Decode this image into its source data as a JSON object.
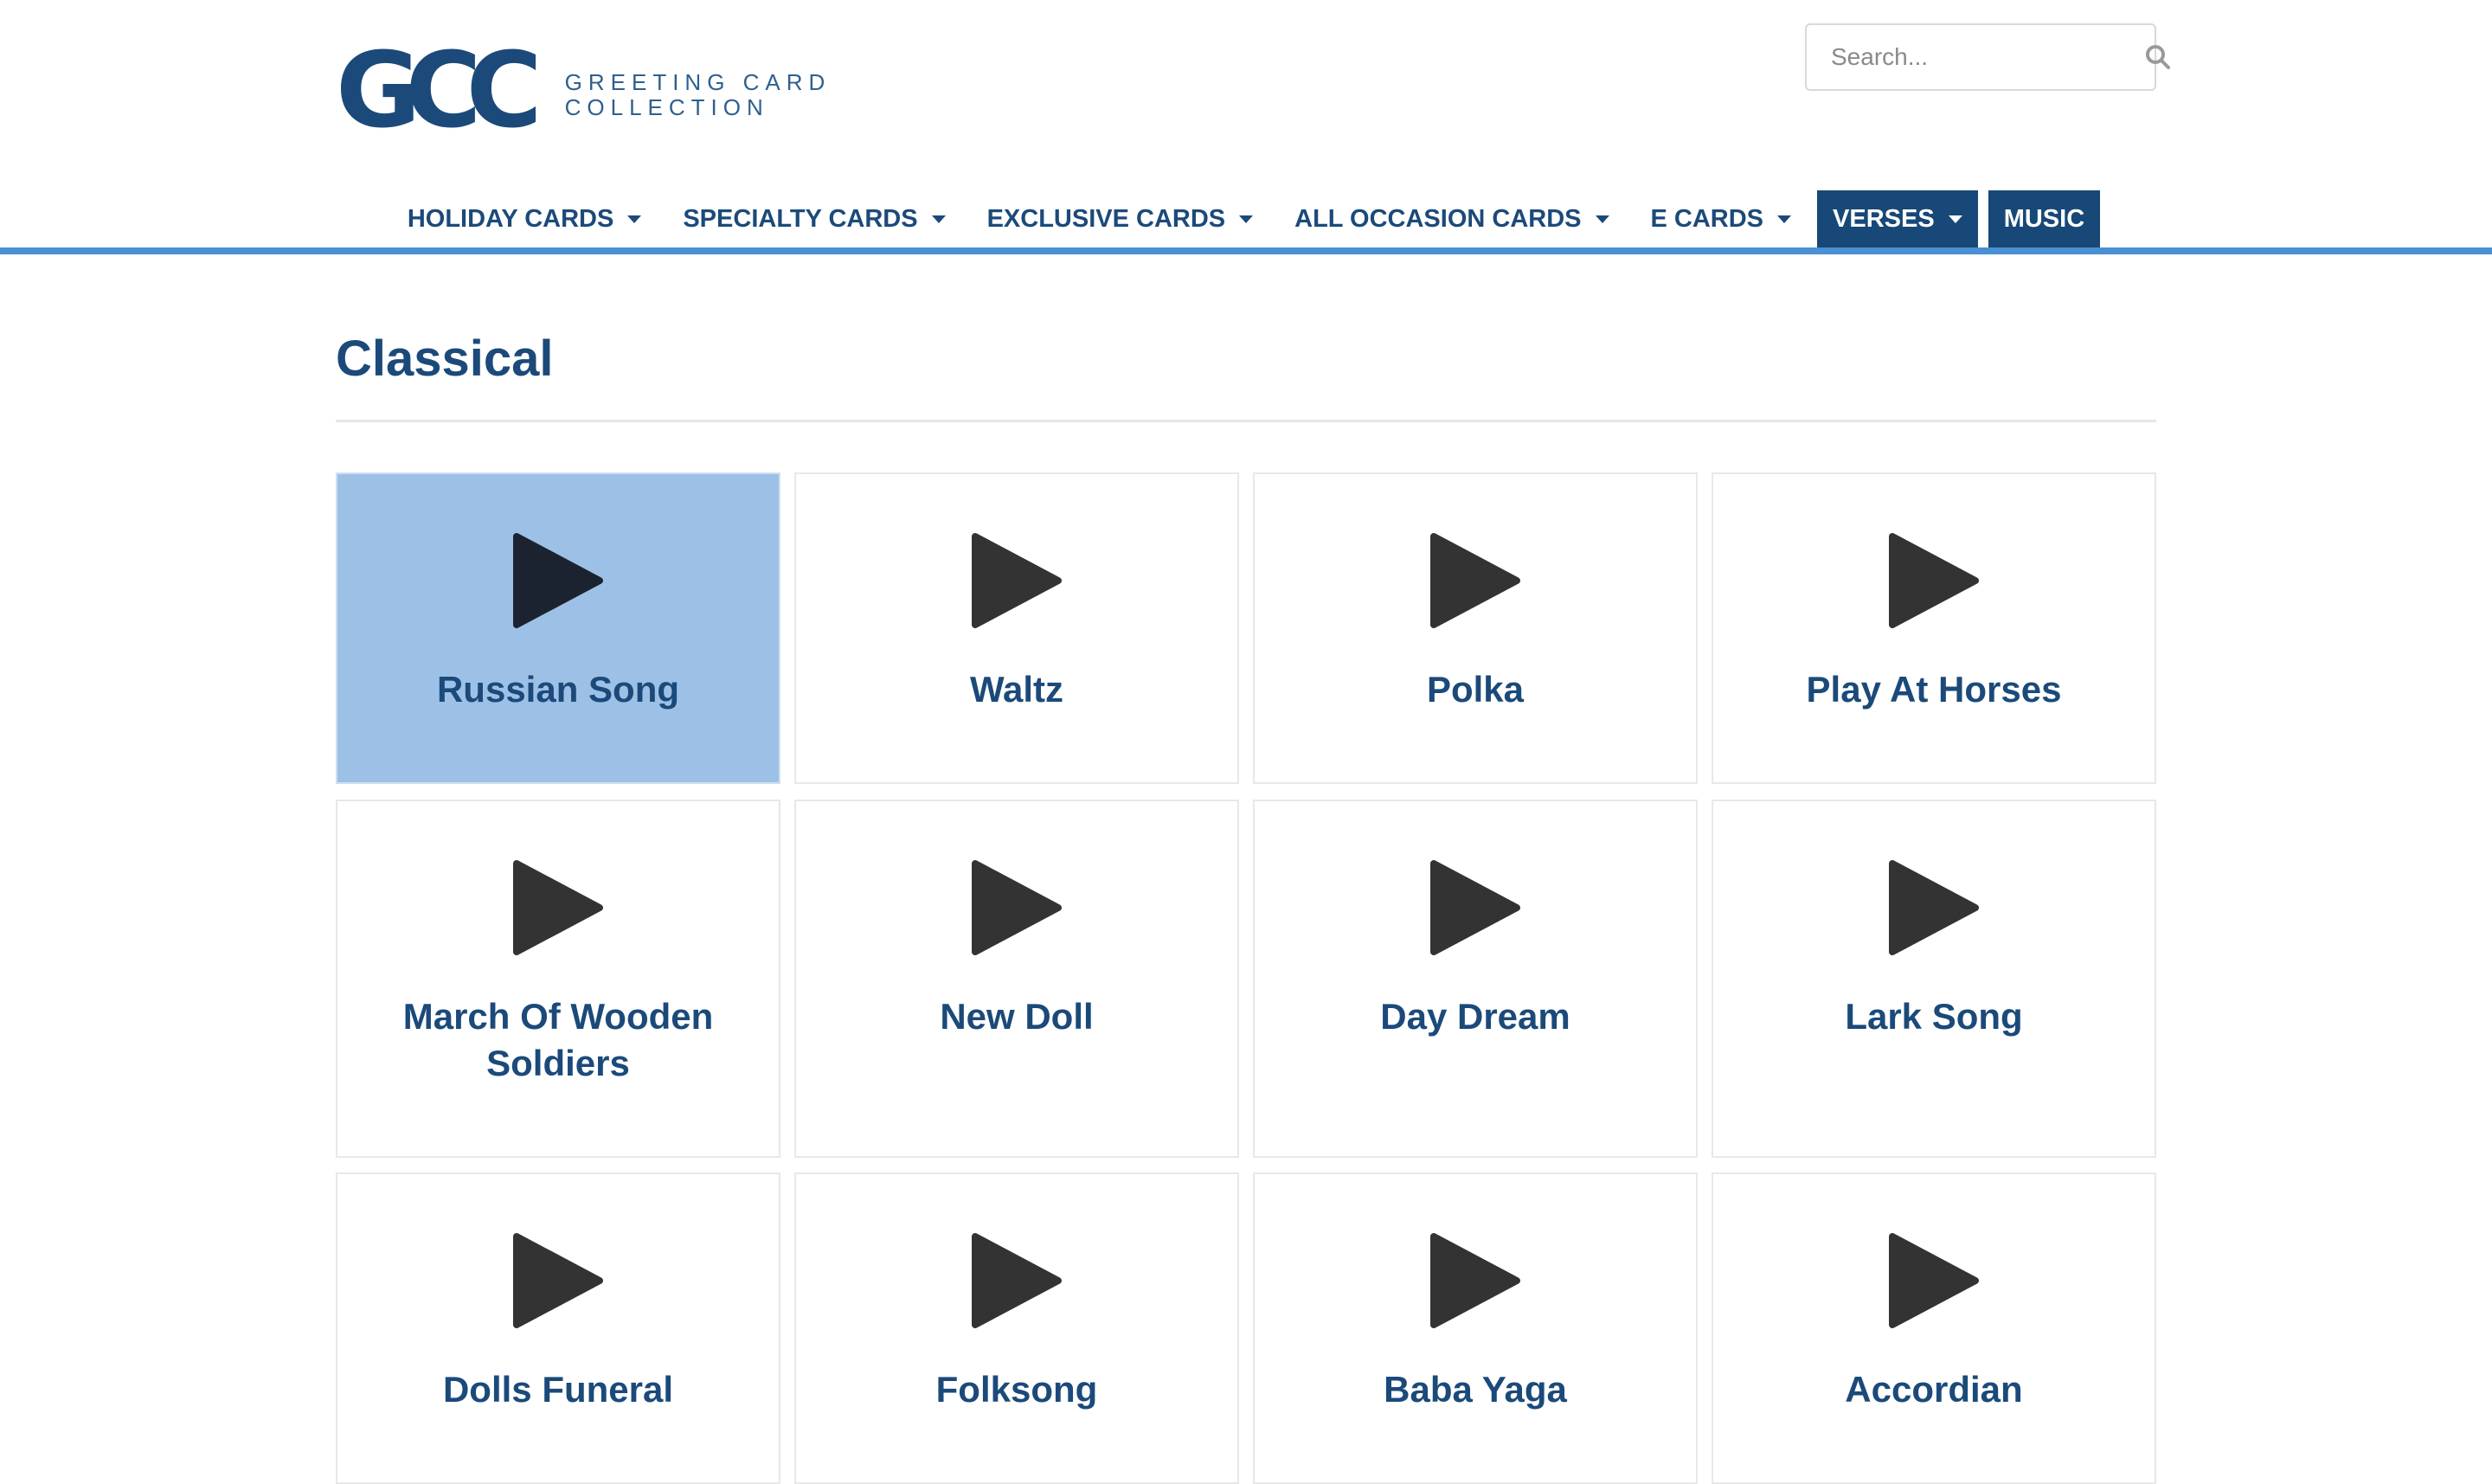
{
  "brand": {
    "logo_mark": "GCC",
    "logo_line1": "GREETING CARD",
    "logo_line2": "COLLECTION",
    "primary_color": "#1b4a7a",
    "accent_color": "#4a90d4",
    "selected_tile_color": "#9dc1e6"
  },
  "search": {
    "placeholder": "Search...",
    "icon": "search-icon"
  },
  "nav": {
    "items": [
      {
        "label": "HOLIDAY CARDS",
        "has_dropdown": true
      },
      {
        "label": "SPECIALTY CARDS",
        "has_dropdown": true
      },
      {
        "label": "EXCLUSIVE CARDS",
        "has_dropdown": true
      },
      {
        "label": "ALL OCCASION CARDS",
        "has_dropdown": true
      },
      {
        "label": "E CARDS",
        "has_dropdown": true
      },
      {
        "label": "VERSES",
        "has_dropdown": true,
        "active": true
      },
      {
        "label": "MUSIC",
        "has_dropdown": false,
        "active": true
      }
    ]
  },
  "page": {
    "title": "Classical"
  },
  "songs": [
    {
      "title": "Russian Song",
      "selected": true,
      "icon": "play-icon"
    },
    {
      "title": "Waltz",
      "icon": "play-icon"
    },
    {
      "title": "Polka",
      "icon": "play-icon"
    },
    {
      "title": "Play At Horses",
      "icon": "play-icon"
    },
    {
      "title": "March Of Wooden Soldiers",
      "icon": "play-icon"
    },
    {
      "title": "New Doll",
      "icon": "play-icon"
    },
    {
      "title": "Day Dream",
      "icon": "play-icon"
    },
    {
      "title": "Lark Song",
      "icon": "play-icon"
    },
    {
      "title": "Dolls Funeral",
      "icon": "play-icon"
    },
    {
      "title": "Folksong",
      "icon": "play-icon"
    },
    {
      "title": "Baba Yaga",
      "icon": "play-icon"
    },
    {
      "title": "Accordian",
      "icon": "play-icon"
    }
  ]
}
